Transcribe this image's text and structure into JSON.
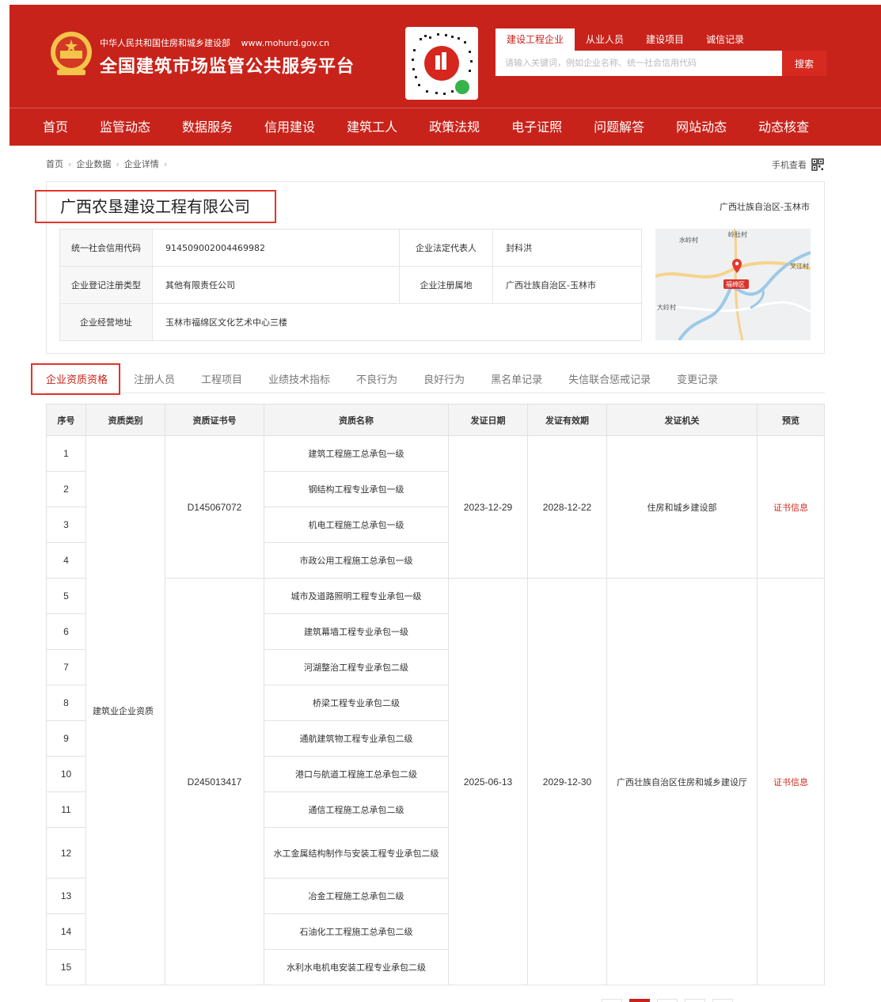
{
  "header": {
    "org_name": "中华人民共和国住房和城乡建设部",
    "org_url": "www.mohurd.gov.cn",
    "site_title": "全国建筑市场监管公共服务平台",
    "search_tabs": [
      "建设工程企业",
      "从业人员",
      "建设项目",
      "诚信记录"
    ],
    "search_placeholder": "请输入关键词，例如企业名称、统一社会信用代码",
    "search_button": "搜索",
    "nav": [
      "首页",
      "监管动态",
      "数据服务",
      "信用建设",
      "建筑工人",
      "政策法规",
      "电子证照",
      "问题解答",
      "网站动态",
      "动态核查"
    ]
  },
  "breadcrumb": [
    "首页",
    "企业数据",
    "企业详情"
  ],
  "mobile_view": "手机查看",
  "company": {
    "name": "广西农垦建设工程有限公司",
    "region": "广西壮族自治区-玉林市",
    "credit_code_label": "统一社会信用代码",
    "credit_code": "914509002004469982",
    "legal_rep_label": "企业法定代表人",
    "legal_rep": "封科洪",
    "reg_type_label": "企业登记注册类型",
    "reg_type": "其他有限责任公司",
    "reg_place_label": "企业注册属地",
    "reg_place": "广西壮族自治区-玉林市",
    "address_label": "企业经营地址",
    "address": "玉林市福绵区文化艺术中心三楼"
  },
  "map": {
    "labels": [
      "水岭村",
      "岭肚村",
      "叉江村",
      "福绵区",
      "大岭村"
    ]
  },
  "tabs": [
    "企业资质资格",
    "注册人员",
    "工程项目",
    "业绩技术指标",
    "不良行为",
    "良好行为",
    "黑名单记录",
    "失信联合惩戒记录",
    "变更记录"
  ],
  "quals": {
    "headers": [
      "序号",
      "资质类别",
      "资质证书号",
      "资质名称",
      "发证日期",
      "发证有效期",
      "发证机关",
      "预览"
    ],
    "category": "建筑业企业资质",
    "preview_label": "证书信息",
    "groups": [
      {
        "cert_no": "D145067072",
        "issue_date": "2023-12-29",
        "valid_until": "2028-12-22",
        "authority": "住房和城乡建设部",
        "items": [
          {
            "no": "1",
            "name": "建筑工程施工总承包一级"
          },
          {
            "no": "2",
            "name": "钢结构工程专业承包一级"
          },
          {
            "no": "3",
            "name": "机电工程施工总承包一级"
          },
          {
            "no": "4",
            "name": "市政公用工程施工总承包一级"
          }
        ]
      },
      {
        "cert_no": "D245013417",
        "issue_date": "2025-06-13",
        "valid_until": "2029-12-30",
        "authority": "广西壮族自治区住房和城乡建设厅",
        "items": [
          {
            "no": "5",
            "name": "城市及道路照明工程专业承包一级"
          },
          {
            "no": "6",
            "name": "建筑幕墙工程专业承包一级"
          },
          {
            "no": "7",
            "name": "河湖整治工程专业承包二级"
          },
          {
            "no": "8",
            "name": "桥梁工程专业承包二级"
          },
          {
            "no": "9",
            "name": "通航建筑物工程专业承包二级"
          },
          {
            "no": "10",
            "name": "港口与航道工程施工总承包二级"
          },
          {
            "no": "11",
            "name": "通信工程施工总承包二级"
          },
          {
            "no": "12",
            "name": "水工金属结构制作与安装工程专业承包二级"
          },
          {
            "no": "13",
            "name": "冶金工程施工总承包二级"
          },
          {
            "no": "14",
            "name": "石油化工工程施工总承包二级"
          },
          {
            "no": "15",
            "name": "水利水电机电安装工程专业承包二级"
          }
        ]
      }
    ]
  },
  "colors": {
    "brand": "#c8231b",
    "highlight_box": "#e5332a",
    "link": "#d42b21"
  }
}
